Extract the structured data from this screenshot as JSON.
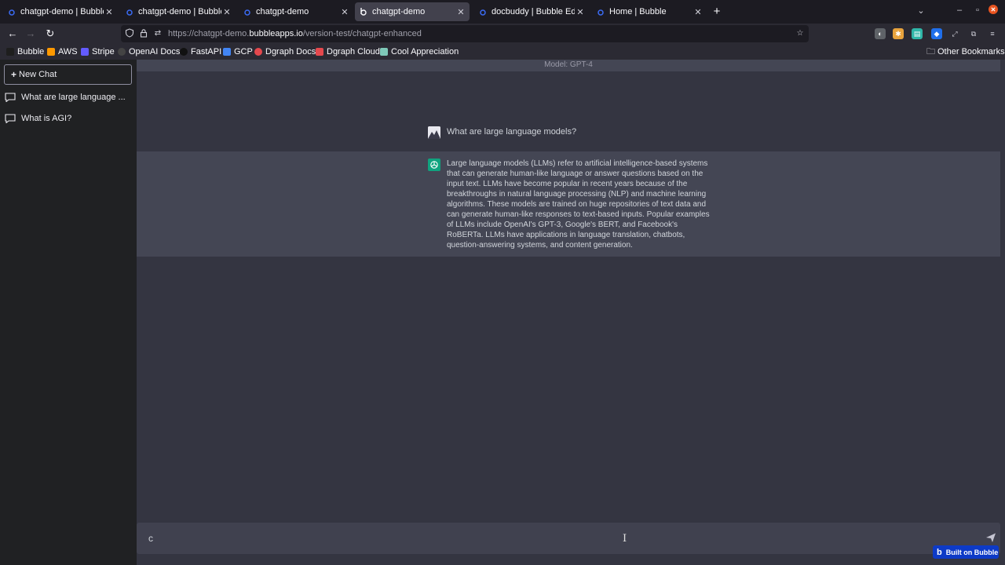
{
  "browser": {
    "tabs": [
      {
        "label": "chatgpt-demo | Bubble Ed",
        "active": false
      },
      {
        "label": "chatgpt-demo | Bubble Ed",
        "active": false
      },
      {
        "label": "chatgpt-demo",
        "active": false
      },
      {
        "label": "chatgpt-demo",
        "active": true
      },
      {
        "label": "docbuddy | Bubble Editor",
        "active": false
      },
      {
        "label": "Home | Bubble",
        "active": false
      }
    ],
    "url_prefix": "https://chatgpt-demo.",
    "url_host": "bubbleapps.io",
    "url_path": "/version-test/chatgpt-enhanced",
    "bookmarks": [
      {
        "label": "Bubble",
        "color": "#1e1e1e"
      },
      {
        "label": "AWS",
        "color": "#ff9900"
      },
      {
        "label": "Stripe",
        "color": "#635bff"
      },
      {
        "label": "OpenAI Docs",
        "color": "#444444"
      },
      {
        "label": "FastAPI",
        "color": "#111111"
      },
      {
        "label": "GCP",
        "color": "#4285f4"
      },
      {
        "label": "Dgraph Docs",
        "color": "#e5484d"
      },
      {
        "label": "Dgraph Cloud",
        "color": "#e5484d"
      },
      {
        "label": "Cool Appreciation",
        "color": "#7ec8b8"
      }
    ],
    "other_bookmarks": "Other Bookmarks"
  },
  "sidebar": {
    "new_chat": "New Chat",
    "conversations": [
      {
        "label": "What are large language ..."
      },
      {
        "label": "What is AGI?"
      }
    ]
  },
  "chat": {
    "model_label": "Model: GPT-4",
    "user_message": "What are large language models?",
    "bot_message": "Large language models (LLMs) refer to artificial intelligence-based systems that can generate human-like language or answer questions based on the input text. LLMs have become popular in recent years because of the breakthroughs in natural language processing (NLP) and machine learning algorithms. These models are trained on huge repositories of text data and can generate human-like responses to text-based inputs. Popular examples of LLMs include OpenAI's GPT-3, Google's BERT, and Facebook's RoBERTa. LLMs have applications in language translation, chatbots, question-answering systems, and content generation.",
    "input_value": "c"
  },
  "badge": {
    "label": "Built on Bubble"
  },
  "colors": {
    "sidebar_bg": "#202123",
    "main_bg": "#343541",
    "bot_row_bg": "#444654",
    "bot_avatar": "#10a37f",
    "badge_bg": "#0d3ac7"
  }
}
